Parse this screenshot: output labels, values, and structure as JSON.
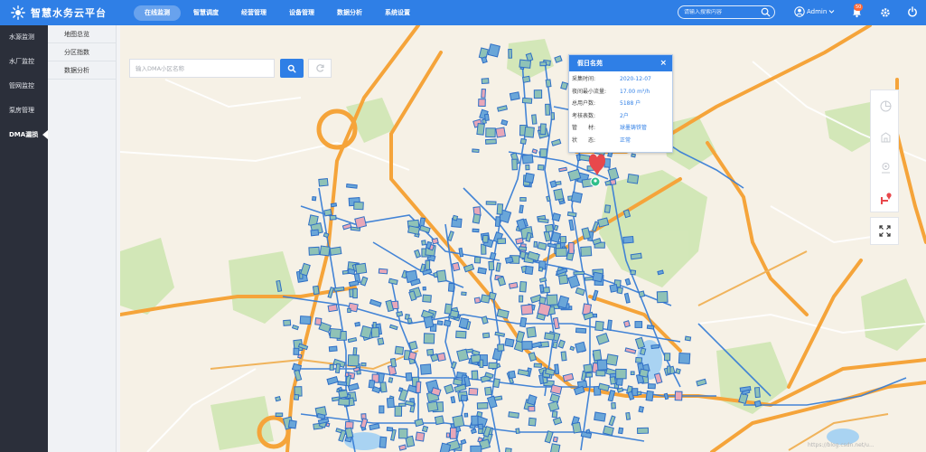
{
  "app": {
    "title": "智慧水务云平台"
  },
  "nav": {
    "items": [
      {
        "label": "在线监测",
        "active": true
      },
      {
        "label": "智慧调度",
        "active": false
      },
      {
        "label": "经营管理",
        "active": false
      },
      {
        "label": "设备管理",
        "active": false
      },
      {
        "label": "数据分析",
        "active": false
      },
      {
        "label": "系统设置",
        "active": false
      }
    ]
  },
  "header": {
    "search_placeholder": "请输入搜索内容",
    "user_name": "Admin",
    "notification_count": "50",
    "icons": {
      "search": "search-icon",
      "user": "user-circle-icon",
      "bell": "bell-icon",
      "settings": "gear-icon",
      "power": "power-icon"
    }
  },
  "sidebar": {
    "items": [
      {
        "label": "水源监测",
        "active": false
      },
      {
        "label": "水厂监控",
        "active": false
      },
      {
        "label": "管网监控",
        "active": false
      },
      {
        "label": "泵房管理",
        "active": false
      },
      {
        "label": "DMA漏损",
        "active": true
      }
    ]
  },
  "submenu": {
    "items": [
      {
        "label": "地图总览"
      },
      {
        "label": "分区指数"
      },
      {
        "label": "数据分析"
      }
    ]
  },
  "map_search": {
    "placeholder": "输入DMA小区名称",
    "value": ""
  },
  "popup": {
    "title": "假日名苑",
    "rows": [
      {
        "key": "采集时间:",
        "value": "2020-12-07"
      },
      {
        "key": "夜间最小流量:",
        "value": "17.00 m³/h"
      },
      {
        "key": "总用户数:",
        "value": "5188 户"
      },
      {
        "key": "考核表数:",
        "value": "2户"
      },
      {
        "key": "管　　材:",
        "value": "球墨铸铁管"
      },
      {
        "key": "状　　态:",
        "value": "正常"
      }
    ]
  },
  "colors": {
    "primary": "#2f7fe6",
    "sidebar_bg": "#2b2f3a",
    "map_bg": "#f6f1e6",
    "road": "#f5a43a",
    "pipe": "#3a7fd6",
    "park": "#cfe6b2",
    "marker": "#e8484c"
  },
  "watermark": "https://blog.csdn.net/u..."
}
